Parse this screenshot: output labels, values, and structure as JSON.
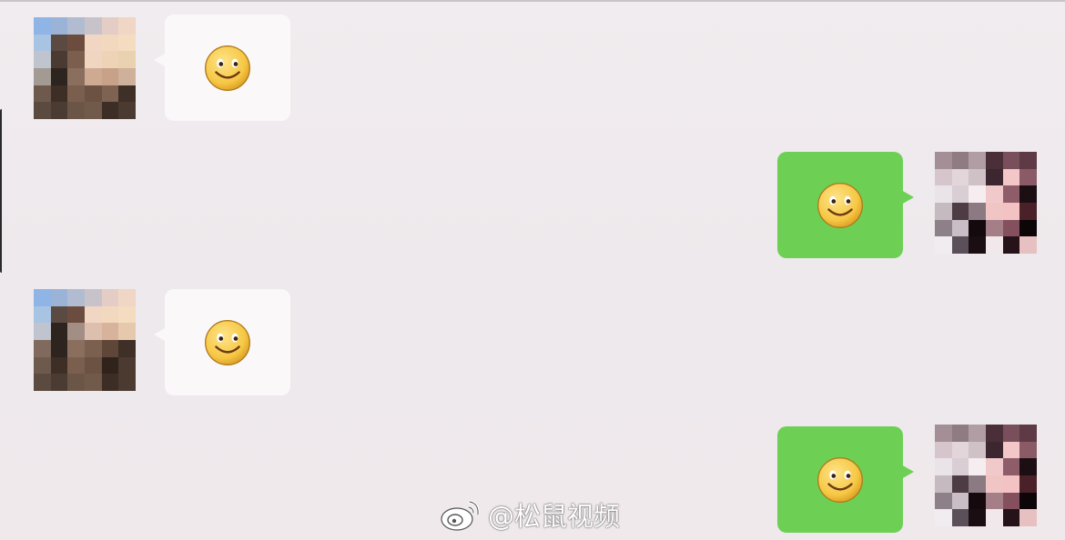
{
  "chat": {
    "messages": [
      {
        "side": "incoming",
        "content": "smiley-emoji"
      },
      {
        "side": "outgoing",
        "content": "smiley-emoji"
      },
      {
        "side": "incoming",
        "content": "smiley-emoji"
      },
      {
        "side": "outgoing",
        "content": "smiley-emoji"
      }
    ]
  },
  "colors": {
    "background": "#efeaec",
    "incoming_bubble": "#fbf8f9",
    "outgoing_bubble": "#6dd055",
    "emoji_face": "#f6c744"
  },
  "watermark": {
    "icon": "weibo-logo-icon",
    "text": "@松鼠视频"
  }
}
